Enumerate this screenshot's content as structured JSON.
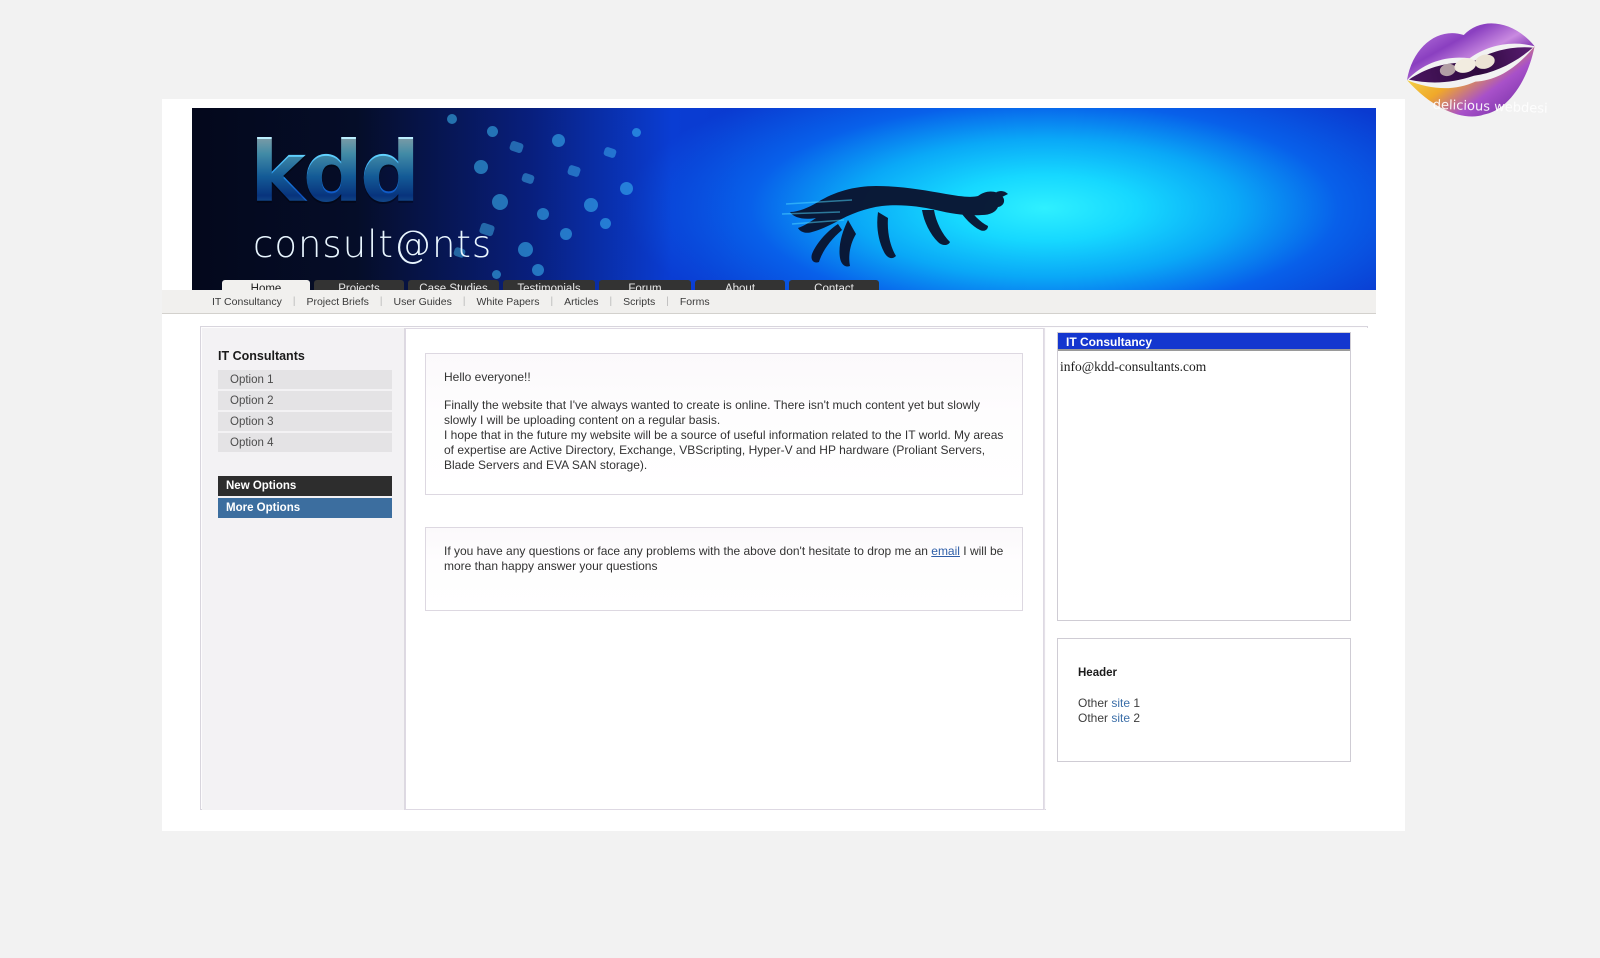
{
  "watermark": {
    "label": "delicious webdesign",
    "icon": "lips-icon"
  },
  "banner": {
    "logo_main": "kdd",
    "logo_sub": "consult@nts",
    "mascot_icon": "running-cheetah-icon"
  },
  "nav": {
    "tabs": [
      {
        "label": "Home",
        "active": true
      },
      {
        "label": "Projects",
        "active": false
      },
      {
        "label": "Case Studies",
        "active": false
      },
      {
        "label": "Testimonials",
        "active": false
      },
      {
        "label": "Forum",
        "active": false
      },
      {
        "label": "About",
        "active": false
      },
      {
        "label": "Contact",
        "active": false
      }
    ],
    "subnav": [
      "IT Consultancy",
      "Project Briefs",
      "User Guides",
      "White Papers",
      "Articles",
      "Scripts",
      "Forms"
    ],
    "subnav_separator": "|"
  },
  "sidebar": {
    "title": "IT Consultants",
    "options": [
      {
        "label": "Option 1"
      },
      {
        "label": "Option 2"
      },
      {
        "label": "Option 3"
      },
      {
        "label": "Option 4"
      }
    ],
    "new_options_label": "New Options",
    "more_options_label": "More Options"
  },
  "main": {
    "note1": {
      "greeting": "Hello everyone!!",
      "para1": "Finally the website that I've always wanted to create is online.  There isn't much content yet but slowly slowly I will be uploading content on a regular basis.",
      "para2": "I hope that in the future my website will be a source of useful information related to the IT world.  My areas of expertise are Active Directory, Exchange, VBScripting, Hyper-V and HP hardware (Proliant Servers, Blade Servers and EVA SAN storage)."
    },
    "note2": {
      "text_before": "If you have any questions or face any problems with the above don't hesitate to drop me an ",
      "link_label": "email",
      "text_after": " I will be more than happy answer your questions"
    }
  },
  "right": {
    "consultancy": {
      "title": "IT Consultancy",
      "email": "info@kdd-consultants.com"
    },
    "header_panel": {
      "title": "Header",
      "links": [
        {
          "prefix": "Other ",
          "link": "site",
          "suffix": " 1"
        },
        {
          "prefix": "Other ",
          "link": "site",
          "suffix": " 2"
        }
      ]
    }
  },
  "colors": {
    "tab_inactive_bg": "#333333",
    "tab_active_bg": "#f1f0ee",
    "accent_blue": "#1436cf",
    "steel_blue": "#3c6e9f",
    "charcoal": "#2d2d2d",
    "link_blue": "#3b6ea8",
    "page_bg": "#f2f2f2"
  }
}
